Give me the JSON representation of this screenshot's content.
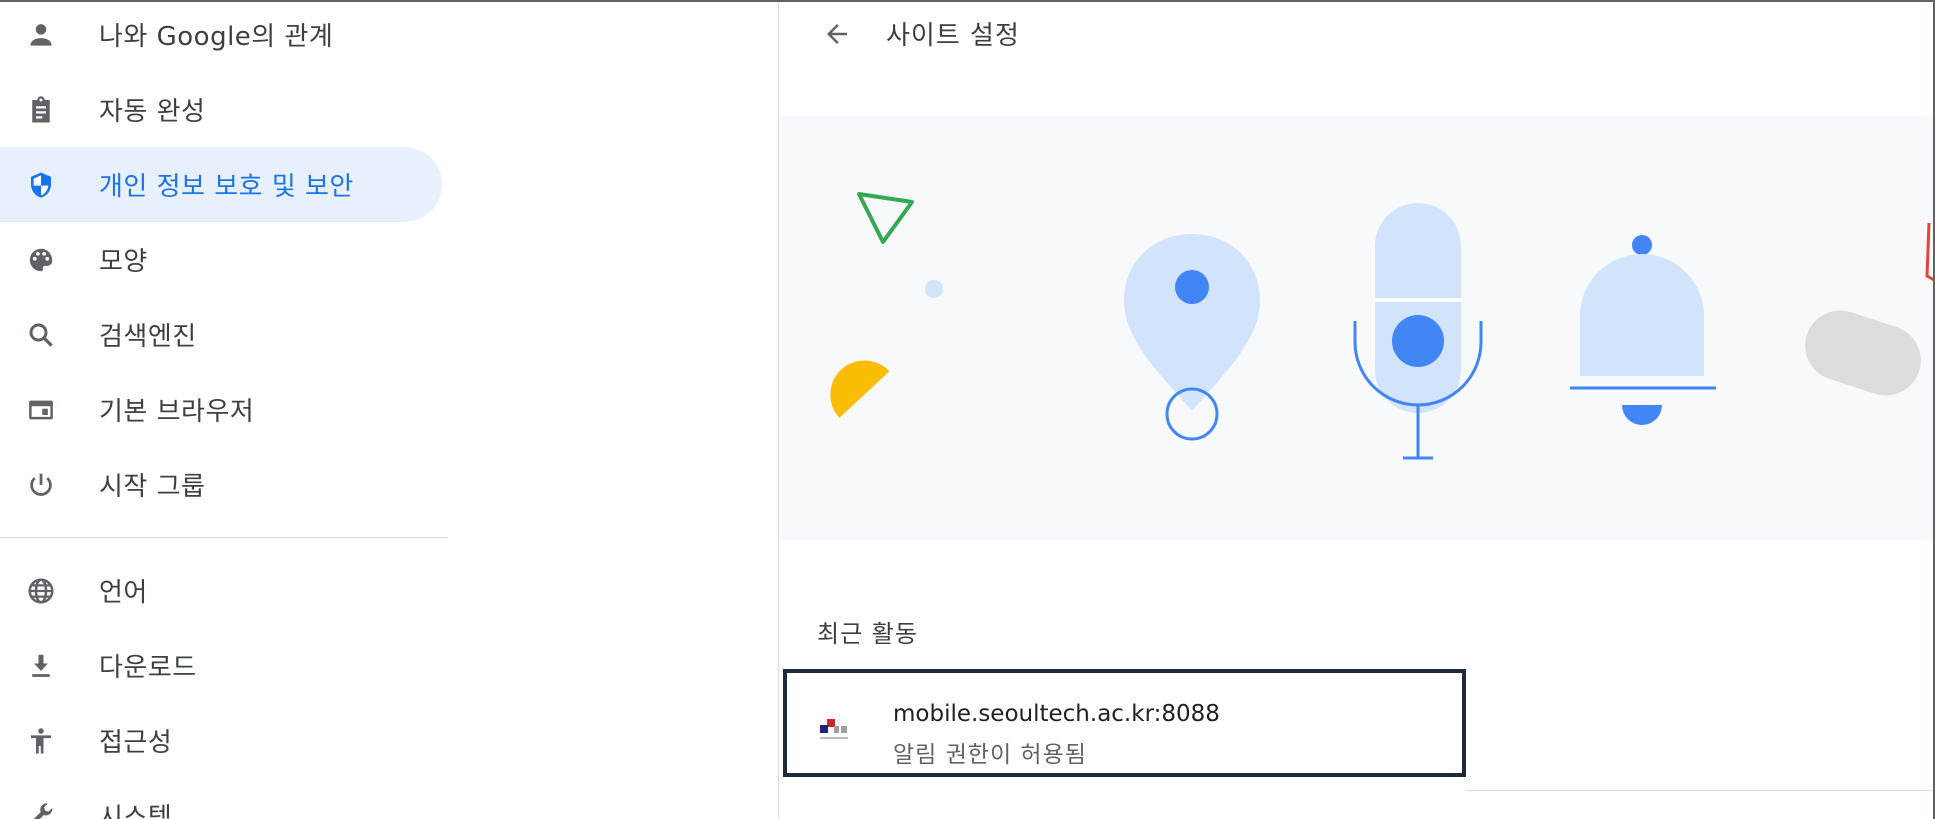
{
  "sidebar": {
    "items": [
      {
        "label": "나와 Google의 관계",
        "icon": "person-icon"
      },
      {
        "label": "자동 완성",
        "icon": "clipboard-icon"
      },
      {
        "label": "개인 정보 보호 및 보안",
        "icon": "shield-icon",
        "active": true
      },
      {
        "label": "모양",
        "icon": "palette-icon"
      },
      {
        "label": "검색엔진",
        "icon": "search-icon"
      },
      {
        "label": "기본 브라우저",
        "icon": "browser-icon"
      },
      {
        "label": "시작 그룹",
        "icon": "power-icon"
      },
      {
        "label": "언어",
        "icon": "globe-icon"
      },
      {
        "label": "다운로드",
        "icon": "download-icon"
      },
      {
        "label": "접근성",
        "icon": "accessibility-icon"
      },
      {
        "label": "시스템",
        "icon": "wrench-icon"
      }
    ]
  },
  "main": {
    "title": "사이트 설정",
    "recent_activity": {
      "label": "최근 활동",
      "items": [
        {
          "site": "mobile.seoultech.ac.kr:8088",
          "description": "알림 권한이 허용됨"
        }
      ]
    }
  },
  "colors": {
    "accent": "#1a73e8",
    "active_bg": "#e8f0fe",
    "icon": "#5f6368",
    "illustration_bg": "#f8f9fa",
    "illustration_blue": "#4285f4",
    "illustration_light_blue": "#d2e3fc",
    "illustration_green": "#34a853",
    "illustration_yellow": "#fbbc04",
    "illustration_red": "#ea4335",
    "illustration_grey": "#dadce0"
  }
}
